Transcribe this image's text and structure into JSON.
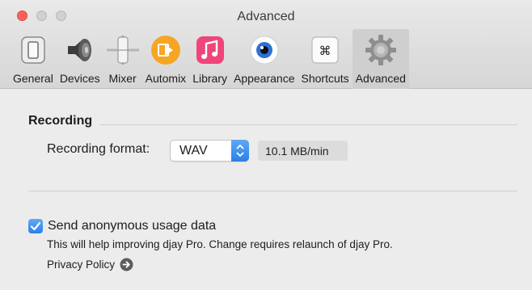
{
  "window": {
    "title": "Advanced"
  },
  "toolbar": {
    "tabs": [
      {
        "label": "General",
        "icon": "switch-icon"
      },
      {
        "label": "Devices",
        "icon": "speaker-icon"
      },
      {
        "label": "Mixer",
        "icon": "fader-icon"
      },
      {
        "label": "Automix",
        "icon": "automix-icon"
      },
      {
        "label": "Library",
        "icon": "music-library-icon"
      },
      {
        "label": "Appearance",
        "icon": "eye-icon"
      },
      {
        "label": "Shortcuts",
        "icon": "command-key-icon"
      },
      {
        "label": "Advanced",
        "icon": "gear-icon"
      }
    ],
    "selected": "Advanced",
    "shortcut_glyph": "⌘"
  },
  "recording": {
    "section_title": "Recording",
    "format_label": "Recording format:",
    "format_value": "WAV",
    "size_value": "10.1 MB/min"
  },
  "usage": {
    "checkbox_label": "Send anonymous usage data",
    "checked": true,
    "help_text": "This will help improving djay Pro. Change requires relaunch of djay Pro.",
    "privacy_link": "Privacy Policy"
  },
  "colors": {
    "accent": "#2c7fe6",
    "close_button": "#fc605b",
    "automix_orange": "#f6a623",
    "library_pink": "#f0457a"
  }
}
